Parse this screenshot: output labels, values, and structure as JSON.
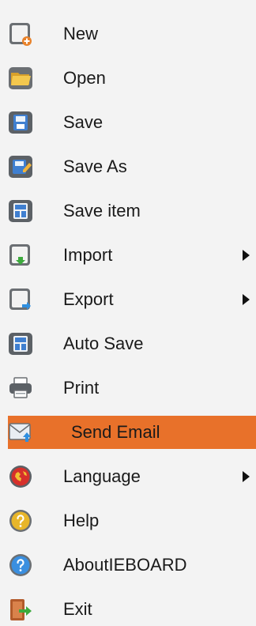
{
  "menu": {
    "items": [
      {
        "label": "New",
        "icon": "new-document-icon"
      },
      {
        "label": "Open",
        "icon": "open-folder-icon"
      },
      {
        "label": "Save",
        "icon": "save-icon"
      },
      {
        "label": "Save As",
        "icon": "save-as-icon"
      },
      {
        "label": "Save item",
        "icon": "save-item-icon"
      },
      {
        "label": "Import",
        "icon": "import-icon",
        "submenu": true
      },
      {
        "label": "Export",
        "icon": "export-icon",
        "submenu": true
      },
      {
        "label": "Auto Save",
        "icon": "auto-save-icon"
      },
      {
        "label": "Print",
        "icon": "printer-icon"
      },
      {
        "label": "Send Email",
        "icon": "email-icon",
        "highlighted": true
      },
      {
        "label": "Language",
        "icon": "globe-icon",
        "submenu": true
      },
      {
        "label": "Help",
        "icon": "help-icon"
      },
      {
        "label": "AboutIEBOARD",
        "icon": "info-icon"
      },
      {
        "label": "Exit",
        "icon": "exit-icon"
      }
    ]
  },
  "colors": {
    "highlight": "#e8712a",
    "background": "#f3f3f3",
    "text": "#1a1a1a"
  }
}
